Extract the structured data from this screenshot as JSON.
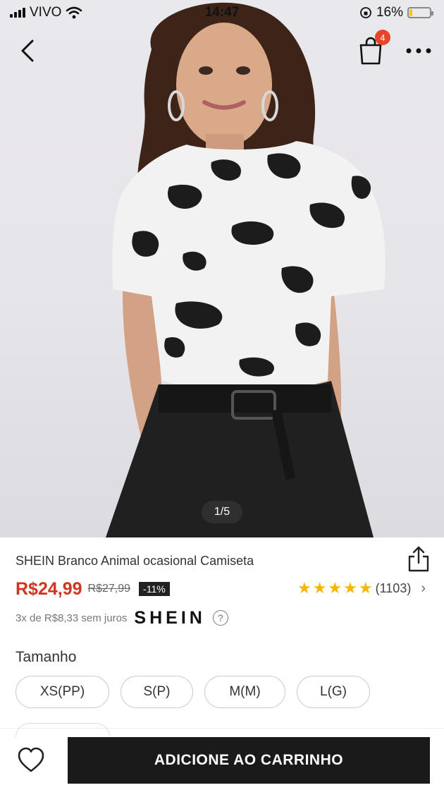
{
  "status_bar": {
    "carrier": "VIVO",
    "time": "14:47",
    "battery_percent": "16%",
    "battery_level": 0.16,
    "icons": [
      "signal-icon",
      "wifi-icon",
      "orientation-lock-icon",
      "battery-icon"
    ]
  },
  "nav": {
    "cart_badge": "4",
    "icons": [
      "back-chevron-icon",
      "shopping-bag-icon",
      "more-dots-icon"
    ]
  },
  "gallery": {
    "page_indicator": "1/5"
  },
  "product": {
    "title": "SHEIN Branco Animal ocasional Camiseta",
    "price": "R$24,99",
    "original_price": "R$27,99",
    "discount": "-11%",
    "rating_stars": 5,
    "review_count": "(1103)",
    "installments": "3x de R$8,33 sem juros",
    "brand_logo": "SHEIN",
    "help_glyph": "?"
  },
  "size": {
    "label": "Tamanho",
    "options": [
      "XS(PP)",
      "S(P)",
      "M(M)",
      "L(G)"
    ]
  },
  "bottom_bar": {
    "add_to_cart_label": "ADICIONE AO CARRINHO"
  },
  "colors": {
    "price_red": "#d0361f",
    "badge_red": "#e8442a",
    "star_yellow": "#f7b500",
    "cta_black": "#1a1a1a"
  }
}
